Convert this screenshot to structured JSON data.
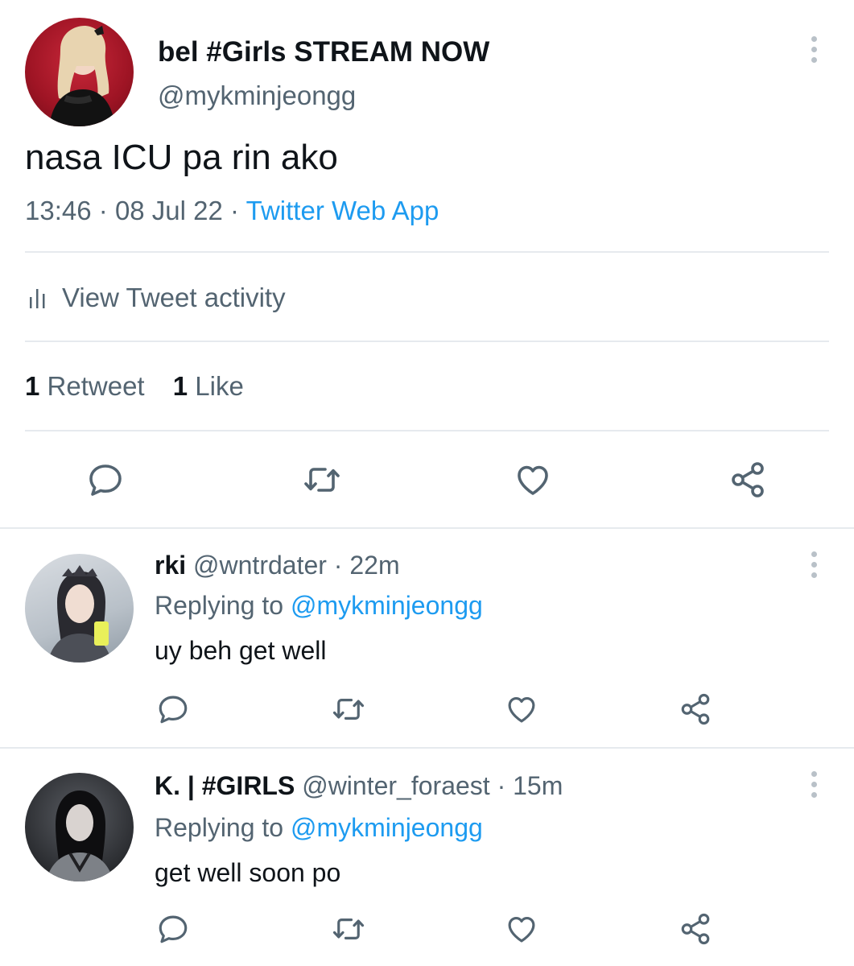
{
  "main_tweet": {
    "display_name": "bel #Girls STREAM NOW",
    "handle": "@mykminjeongg",
    "text": "nasa ICU pa rin ako",
    "time": "13:46",
    "separator1": "·",
    "date": "08 Jul 22",
    "separator2": "·",
    "source": "Twitter Web App",
    "activity_label": "View Tweet activity",
    "retweet_count": "1",
    "retweet_label": "Retweet",
    "like_count": "1",
    "like_label": "Like"
  },
  "replies": [
    {
      "display_name": "rki",
      "handle": "@wntrdater",
      "sep": "·",
      "time": "22m",
      "replying_prefix": "Replying to",
      "replying_to": "@mykminjeongg",
      "text": "uy beh get well"
    },
    {
      "display_name": "K. | #GIRLS",
      "handle": "@winter_foraest",
      "sep": "·",
      "time": "15m",
      "replying_prefix": "Replying to",
      "replying_to": "@mykminjeongg",
      "text": "get well soon po"
    }
  ],
  "icons": {
    "reply": "reply-icon",
    "retweet": "retweet-icon",
    "like": "heart-icon",
    "share": "share-icon",
    "more": "more-vertical-icon",
    "activity": "bar-chart-icon"
  },
  "colors": {
    "accent": "#1d9bf0",
    "secondary_text": "#536471",
    "divider": "#e6eaee"
  }
}
